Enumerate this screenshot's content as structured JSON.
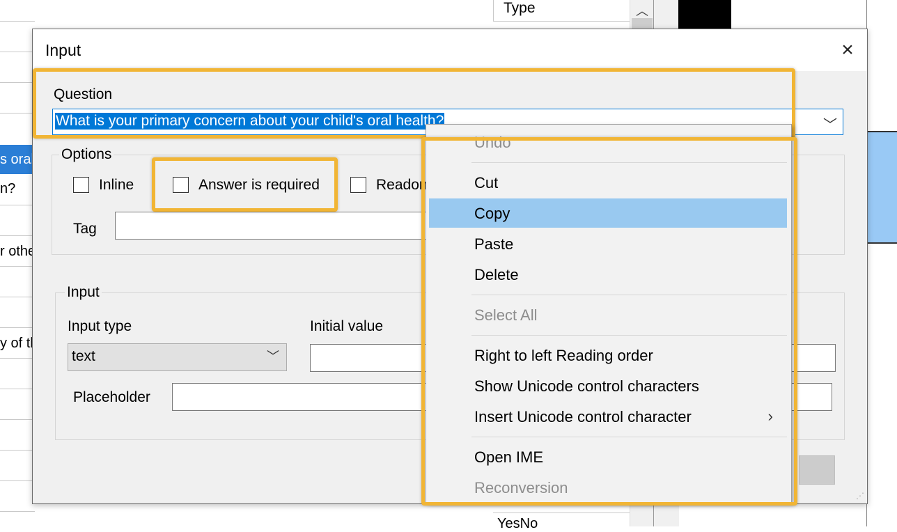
{
  "background": {
    "type_header": "Type",
    "left_cells": [
      "s oral",
      "n?",
      "r othe",
      "y of th"
    ],
    "bottom_cell": "YesNo"
  },
  "dialog": {
    "title": "Input",
    "close_label": "×",
    "question": {
      "label": "Question",
      "value": "What is your primary concern about your child's oral health?"
    },
    "options": {
      "group_label": "Options",
      "inline_label": "Inline",
      "required_label": "Answer is required",
      "readonly_label": "Readon",
      "tag_label": "Tag",
      "tag_value": ""
    },
    "input": {
      "group_label": "Input",
      "input_type_label": "Input type",
      "input_type_value": "text",
      "initial_value_label": "Initial value",
      "initial_value": "",
      "placeholder_label": "Placeholder",
      "placeholder_value": ""
    }
  },
  "context_menu": {
    "items": [
      {
        "label": "Undo",
        "enabled": false
      },
      {
        "label": "Cut",
        "enabled": true
      },
      {
        "label": "Copy",
        "enabled": true,
        "highlighted": true
      },
      {
        "label": "Paste",
        "enabled": true
      },
      {
        "label": "Delete",
        "enabled": true
      },
      {
        "label": "Select All",
        "enabled": false
      },
      {
        "label": "Right to left Reading order",
        "enabled": true
      },
      {
        "label": "Show Unicode control characters",
        "enabled": true
      },
      {
        "label": "Insert Unicode control character",
        "enabled": true,
        "submenu": true
      },
      {
        "label": "Open IME",
        "enabled": true
      },
      {
        "label": "Reconversion",
        "enabled": false
      }
    ]
  },
  "colors": {
    "highlight_border": "#f1b535",
    "selection": "#0078d7",
    "menu_hover": "#99c9f0"
  }
}
